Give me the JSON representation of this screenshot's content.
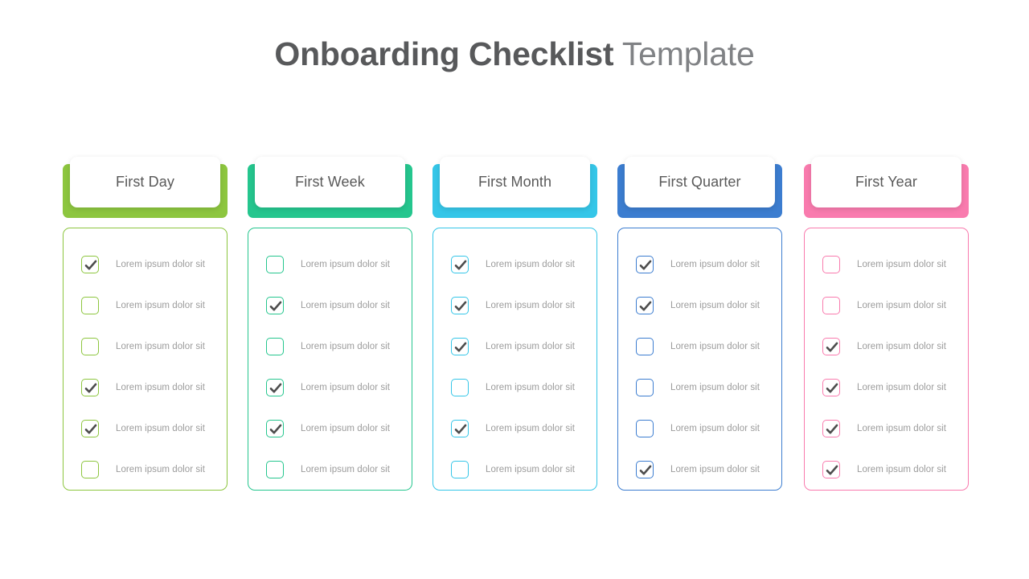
{
  "title": {
    "bold_part": "Onboarding Checklist",
    "light_part": " Template"
  },
  "columns": [
    {
      "header": "First Day",
      "color": "#8DC63F",
      "items": [
        {
          "label": "Lorem ipsum dolor sit",
          "checked": true
        },
        {
          "label": "Lorem ipsum dolor sit",
          "checked": false
        },
        {
          "label": "Lorem ipsum dolor sit",
          "checked": false
        },
        {
          "label": "Lorem ipsum dolor sit",
          "checked": true
        },
        {
          "label": "Lorem ipsum dolor sit",
          "checked": true
        },
        {
          "label": "Lorem ipsum dolor sit",
          "checked": false
        }
      ]
    },
    {
      "header": "First Week",
      "color": "#25C68E",
      "items": [
        {
          "label": "Lorem ipsum dolor sit",
          "checked": false
        },
        {
          "label": "Lorem ipsum dolor sit",
          "checked": true
        },
        {
          "label": "Lorem ipsum dolor sit",
          "checked": false
        },
        {
          "label": "Lorem ipsum dolor sit",
          "checked": true
        },
        {
          "label": "Lorem ipsum dolor sit",
          "checked": true
        },
        {
          "label": "Lorem ipsum dolor sit",
          "checked": false
        }
      ]
    },
    {
      "header": "First Month",
      "color": "#35C6E8",
      "items": [
        {
          "label": "Lorem ipsum dolor sit",
          "checked": true
        },
        {
          "label": "Lorem ipsum dolor sit",
          "checked": true
        },
        {
          "label": "Lorem ipsum dolor sit",
          "checked": true
        },
        {
          "label": "Lorem ipsum dolor sit",
          "checked": false
        },
        {
          "label": "Lorem ipsum dolor sit",
          "checked": true
        },
        {
          "label": "Lorem ipsum dolor sit",
          "checked": false
        }
      ]
    },
    {
      "header": "First Quarter",
      "color": "#3C7DD0",
      "items": [
        {
          "label": "Lorem ipsum dolor sit",
          "checked": true
        },
        {
          "label": "Lorem ipsum dolor sit",
          "checked": true
        },
        {
          "label": "Lorem ipsum dolor sit",
          "checked": false
        },
        {
          "label": "Lorem ipsum dolor sit",
          "checked": false
        },
        {
          "label": "Lorem ipsum dolor sit",
          "checked": false
        },
        {
          "label": "Lorem ipsum dolor sit",
          "checked": true
        }
      ]
    },
    {
      "header": "First Year",
      "color": "#F97BAE",
      "items": [
        {
          "label": "Lorem ipsum dolor sit",
          "checked": false
        },
        {
          "label": "Lorem ipsum dolor sit",
          "checked": false
        },
        {
          "label": "Lorem ipsum dolor sit",
          "checked": true
        },
        {
          "label": "Lorem ipsum dolor sit",
          "checked": true
        },
        {
          "label": "Lorem ipsum dolor sit",
          "checked": true
        },
        {
          "label": "Lorem ipsum dolor sit",
          "checked": true
        }
      ]
    }
  ],
  "checkmark_color": "#4d4d4d"
}
